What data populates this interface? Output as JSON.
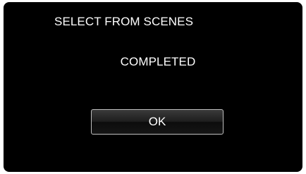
{
  "dialog": {
    "title": "SELECT FROM SCENES",
    "message": "COMPLETED",
    "ok_label": "OK"
  },
  "colors": {
    "screen_background": "#000000",
    "text": "#ffffff",
    "button_border": "#bfbfbf"
  }
}
